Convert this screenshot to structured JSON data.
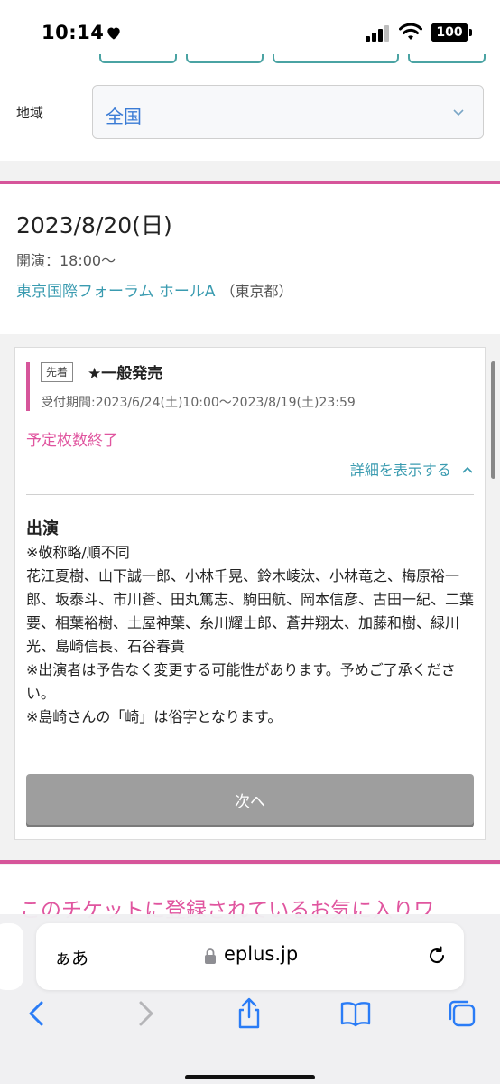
{
  "status_bar": {
    "time": "10:14",
    "battery": "100"
  },
  "region": {
    "label": "地域",
    "value": "全国"
  },
  "event": {
    "date": "2023/8/20(日)",
    "time": "開演：18:00～",
    "venue": "東京国際フォーラム ホールA",
    "prefecture": "（東京都）"
  },
  "sale": {
    "tag": "先着",
    "title": "★一般発売",
    "period": "受付期間:2023/6/24(土)10:00～2023/8/19(土)23:59",
    "status": "予定枚数終了",
    "detail_link": "詳細を表示する"
  },
  "cast": {
    "heading": "出演",
    "lines": [
      "※敬称略/順不同",
      "花江夏樹、山下誠一郎、小林千晃、鈴木崚汰、小林竜之、梅原裕一郎、坂泰斗、市川蒼、田丸篤志、駒田航、岡本信彦、古田一紀、二葉要、相葉裕樹、土屋神葉、糸川耀士郎、蒼井翔太、加藤和樹、緑川光、島崎信長、石谷春貴",
      "※出演者は予告なく変更する可能性があります。予めご了承ください。",
      "※島崎さんの「崎」は俗字となります。"
    ]
  },
  "next_button": "次へ",
  "favorites_text": "このチケットに登録されているお気に入りワ",
  "safari": {
    "aa": "ぁあ",
    "url": "eplus.jp"
  },
  "colors": {
    "accent_pink": "#d6559a",
    "link_teal": "#3a9bb0",
    "select_blue": "#3a7bd5",
    "safari_blue": "#2a7cf6"
  },
  "icons": [
    "heart-icon",
    "cellular-signal-icon",
    "wifi-icon",
    "chevron-down-icon",
    "chevron-up-icon",
    "lock-icon",
    "reload-icon",
    "back-icon",
    "forward-icon",
    "share-icon",
    "bookmarks-icon",
    "tabs-icon"
  ]
}
